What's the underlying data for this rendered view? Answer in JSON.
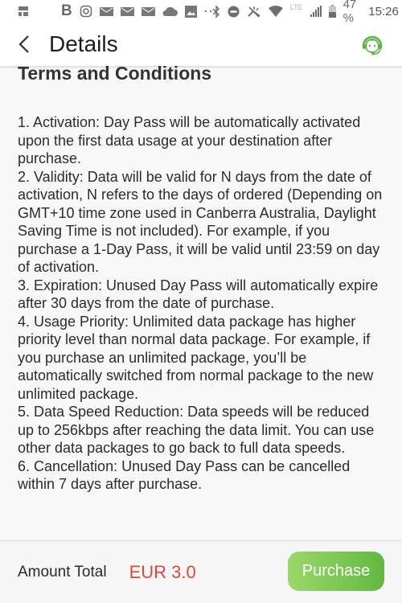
{
  "status_bar": {
    "left_icons": [
      "app-grid-icon",
      "b-app-icon",
      "instagram-icon",
      "mail-icon",
      "mail-icon",
      "mail-icon",
      "cloud-icon",
      "gallery-icon",
      "more-dots-icon"
    ],
    "right_icons": [
      "bluetooth-icon",
      "do-not-disturb-icon",
      "data-saver-icon",
      "wifi-icon",
      "lte-icon",
      "signal-icon",
      "battery-icon"
    ],
    "b_glyph": "B",
    "lte": "LTE",
    "battery_percent": "47 %",
    "time": "15:26"
  },
  "header": {
    "back_icon": "chevron-left-icon",
    "title": "Details",
    "support_icon": "customer-support-headset-icon",
    "support_color": "#5cb347"
  },
  "content": {
    "section_title": "Terms and Conditions",
    "terms": [
      "1. Activation: Day Pass will be automatically activated upon the first data usage at your destination after purchase.",
      "2. Validity: Data will be valid for N days from the date of activation, N refers to the days of ordered (Depending on GMT+10 time zone used in Canberra Australia, Daylight Saving Time is not included). For example, if you purchase a 1-Day Pass, it will be valid until 23:59 on day of activation.",
      "3. Expiration: Unused Day Pass will automatically expire after 30 days from the date of purchase.",
      "4. Usage Priority: Unlimited data package has higher priority level than normal data package. For example, if you purchase an unlimited package, you’ll be automatically switched from normal package to the new unlimited package.",
      "5. Data Speed Reduction: Data speeds will be reduced up to 256kbps after reaching the data limit. You can use other data packages to go back to full data speeds.",
      "6. Cancellation: Unused Day Pass can be cancelled within 7 days after purchase."
    ]
  },
  "footer": {
    "amount_label": "Amount Total",
    "amount_value": "EUR 3.0",
    "amount_color": "#e2453f",
    "purchase_label": "Purchase",
    "purchase_color": "#6fc04c"
  }
}
